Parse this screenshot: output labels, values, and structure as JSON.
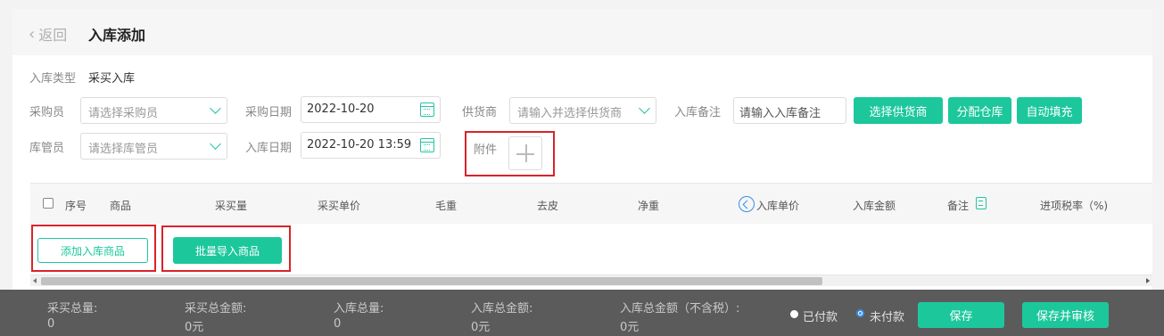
{
  "header": {
    "back_label": "返回",
    "title": "入库添加"
  },
  "form": {
    "type_label": "入库类型",
    "type_value": "采买入库",
    "buyer_label": "采购员",
    "buyer_placeholder": "请选择采购员",
    "purchase_date_label": "采购日期",
    "purchase_date_value": "2022-10-20",
    "supplier_label": "供货商",
    "supplier_placeholder": "请输入并选择供货商",
    "remark_label": "入库备注",
    "remark_placeholder": "请输入入库备注",
    "keeper_label": "库管员",
    "keeper_placeholder": "请选择库管员",
    "stock_date_label": "入库日期",
    "stock_date_value": "2022-10-20 13:59",
    "attachment_label": "附件"
  },
  "actions": {
    "select_supplier": "选择供货商",
    "assign_warehouse": "分配仓库",
    "auto_fill": "自动填充"
  },
  "table": {
    "headers": [
      "序号",
      "商品",
      "采买量",
      "采买单价",
      "毛重",
      "去皮",
      "净重",
      "入库单价",
      "入库金额",
      "备注",
      "进项税率（%)"
    ]
  },
  "table_actions": {
    "add_item": "添加入库商品",
    "batch_import": "批量导入商品"
  },
  "footer": {
    "summary": [
      {
        "label": "采买总量:",
        "value": "0"
      },
      {
        "label": "采买总金额:",
        "value": "0元"
      },
      {
        "label": "入库总量:",
        "value": "0"
      },
      {
        "label": "入库总金额:",
        "value": "0元"
      },
      {
        "label": "入库总金额（不含税）:",
        "value": "0元"
      }
    ],
    "paid_label": "已付款",
    "unpaid_label": "未付款",
    "save_label": "保存",
    "save_audit_label": "保存并审核"
  },
  "colors": {
    "accent": "#1dc79c",
    "highlight": "#d9232a",
    "footer_bg": "#5b5b5b",
    "link_blue": "#3a8ee6"
  },
  "payment_status": "unpaid"
}
